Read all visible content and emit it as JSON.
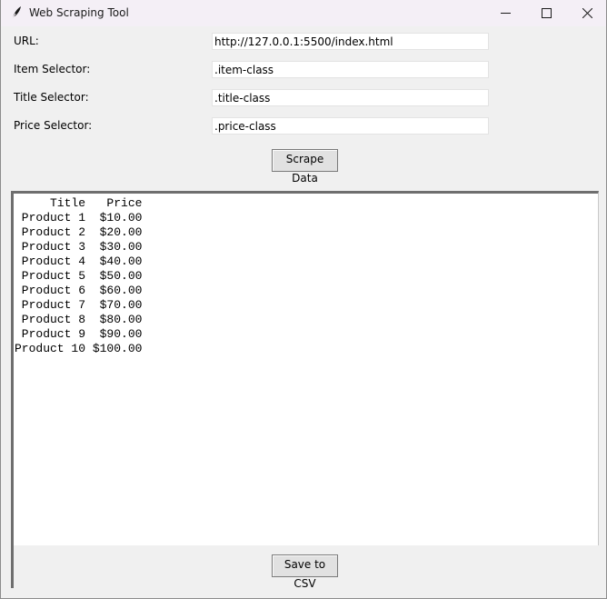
{
  "window": {
    "title": "Web Scraping Tool",
    "icon": "feather-icon",
    "controls": [
      "minimize-icon",
      "maximize-icon",
      "close-icon"
    ]
  },
  "form": {
    "url_label": "URL:",
    "url_value": "http://127.0.0.1:5500/index.html",
    "item_label": "Item Selector:",
    "item_value": ".item-class",
    "title_label": "Title Selector:",
    "title_value": ".title-class",
    "price_label": "Price Selector:",
    "price_value": ".price-class"
  },
  "actions": {
    "scrape_label": "Scrape Data",
    "save_label": "Save to CSV"
  },
  "output": {
    "headers": [
      "Title",
      "Price"
    ],
    "rows": [
      [
        "Product 1",
        "$10.00"
      ],
      [
        "Product 2",
        "$20.00"
      ],
      [
        "Product 3",
        "$30.00"
      ],
      [
        "Product 4",
        "$40.00"
      ],
      [
        "Product 5",
        "$50.00"
      ],
      [
        "Product 6",
        "$60.00"
      ],
      [
        "Product 7",
        "$70.00"
      ],
      [
        "Product 8",
        "$80.00"
      ],
      [
        "Product 9",
        "$90.00"
      ],
      [
        "Product 10",
        "$100.00"
      ]
    ]
  }
}
